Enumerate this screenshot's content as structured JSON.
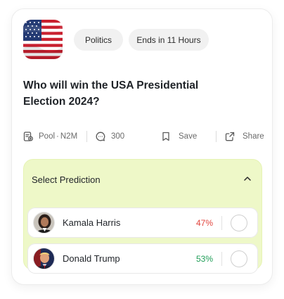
{
  "market": {
    "category": "Politics",
    "deadline": "Ends in 11 Hours",
    "question": "Who will win the USA Presidential Election 2024?",
    "flag_icon": "usa-flag-icon"
  },
  "meta": {
    "pool_label": "Pool",
    "pool_dot": "·",
    "pool_value": "N2M",
    "comments_count": "300",
    "save_label": "Save",
    "share_label": "Share"
  },
  "prediction": {
    "header": "Select Prediction",
    "expanded": true,
    "options": [
      {
        "name": "Kamala Harris",
        "percent": "47%",
        "percent_color": "#e2463f",
        "selected": false
      },
      {
        "name": "Donald Trump",
        "percent": "53%",
        "percent_color": "#1f9d57",
        "selected": false
      }
    ]
  },
  "colors": {
    "prediction_bg": "#eef8c8",
    "chip_bg": "#f1f1f1",
    "text": "#1f2328",
    "muted": "#6b6b6b"
  }
}
